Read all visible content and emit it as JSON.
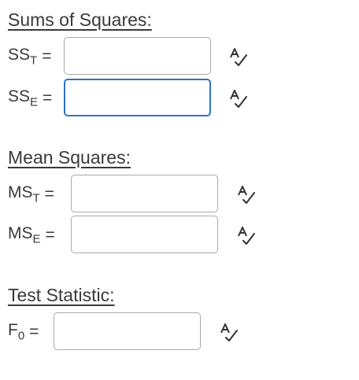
{
  "sections": [
    {
      "heading": "Sums of Squares:",
      "fields": [
        {
          "symbol": "SS",
          "subscript": "T",
          "equals": "=",
          "value": "",
          "focused": false
        },
        {
          "symbol": "SS",
          "subscript": "E",
          "equals": "=",
          "value": "",
          "focused": true
        }
      ]
    },
    {
      "heading": "Mean Squares:",
      "fields": [
        {
          "symbol": "MS",
          "subscript": "T",
          "equals": "=",
          "value": "",
          "focused": false
        },
        {
          "symbol": "MS",
          "subscript": "E",
          "equals": "=",
          "value": "",
          "focused": false
        }
      ]
    },
    {
      "heading": "Test Statistic:",
      "fields": [
        {
          "symbol": "F",
          "subscript": "0",
          "equals": "=",
          "value": "",
          "focused": false
        }
      ]
    }
  ],
  "icons": {
    "check_answer": "spell-check-icon"
  },
  "colors": {
    "text": "#3a3a3a",
    "input_border": "#a9a9a9",
    "focus_border": "#2f73bf"
  }
}
